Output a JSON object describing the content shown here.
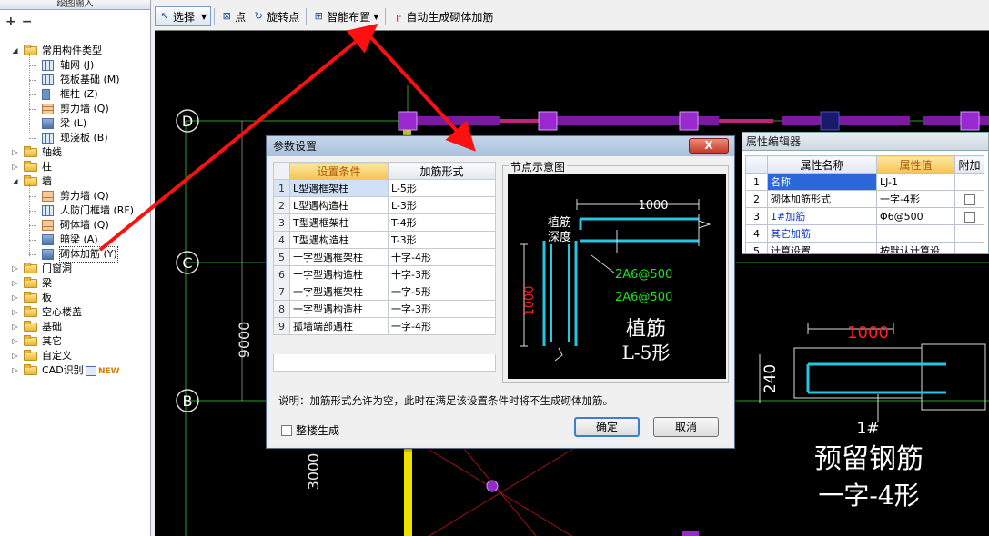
{
  "left_panel": {
    "header": "绘图输入",
    "tools": [
      "+",
      "−"
    ],
    "tree": [
      {
        "label": "常用构件类型",
        "shortcut": ""
      },
      {
        "label": "轴网",
        "shortcut": "(J)"
      },
      {
        "label": "筏板基础",
        "shortcut": "(M)"
      },
      {
        "label": "框柱",
        "shortcut": "(Z)"
      },
      {
        "label": "剪力墙",
        "shortcut": "(Q)"
      },
      {
        "label": "梁",
        "shortcut": "(L)"
      },
      {
        "label": "现浇板",
        "shortcut": "(B)"
      },
      {
        "label": "轴线",
        "shortcut": ""
      },
      {
        "label": "柱",
        "shortcut": ""
      },
      {
        "label": "墙",
        "shortcut": ""
      },
      {
        "label": "剪力墙",
        "shortcut": "(Q)"
      },
      {
        "label": "人防门框墙",
        "shortcut": "(RF)"
      },
      {
        "label": "砌体墙",
        "shortcut": "(Q)"
      },
      {
        "label": "暗梁",
        "shortcut": "(A)"
      },
      {
        "label": "砌体加筋",
        "shortcut": "(Y)"
      },
      {
        "label": "门窗洞",
        "shortcut": ""
      },
      {
        "label": "梁",
        "shortcut": ""
      },
      {
        "label": "板",
        "shortcut": ""
      },
      {
        "label": "空心楼盖",
        "shortcut": ""
      },
      {
        "label": "基础",
        "shortcut": ""
      },
      {
        "label": "其它",
        "shortcut": ""
      },
      {
        "label": "自定义",
        "shortcut": ""
      },
      {
        "label": "CAD识别",
        "shortcut": "",
        "badge": "NEW"
      }
    ]
  },
  "toolbar": {
    "select": "选择",
    "point": "点",
    "rotate_point": "旋转点",
    "smart_layout": "智能布置",
    "auto_generate": "自动生成砌体加筋"
  },
  "canvas": {
    "axes": [
      "D",
      "C",
      "B"
    ],
    "dimensions": [
      "9000",
      "3000"
    ]
  },
  "property_editor": {
    "title": "属性编辑器",
    "headers": [
      "属性名称",
      "属性值",
      "附加"
    ],
    "rows": [
      {
        "num": "1",
        "name": "名称",
        "value": "LJ-1",
        "check": false
      },
      {
        "num": "2",
        "name": "砌体加筋形式",
        "value": "一字-4形",
        "check": true
      },
      {
        "num": "3",
        "name": "1#加筋",
        "value": "Φ6@500",
        "check": true
      },
      {
        "num": "4",
        "name": "其它加筋",
        "value": "",
        "check": false
      },
      {
        "num": "5",
        "name": "计算设置",
        "value": "按默认计算设",
        "check": false
      }
    ]
  },
  "right_preview": {
    "dimension": "1000",
    "side_dim": "240",
    "bar_label": "1#",
    "caption_line1": "预留钢筋",
    "caption_line2": "一字-4形"
  },
  "dialog": {
    "title": "参数设置",
    "close": "X",
    "headers": [
      "设置条件",
      "加筋形式"
    ],
    "rows": [
      {
        "num": "1",
        "condition": "L型遇框架柱",
        "form": "L-5形"
      },
      {
        "num": "2",
        "condition": "L型遇构造柱",
        "form": "L-3形"
      },
      {
        "num": "3",
        "condition": "T型遇框架柱",
        "form": "T-4形"
      },
      {
        "num": "4",
        "condition": "T型遇构造柱",
        "form": "T-3形"
      },
      {
        "num": "5",
        "condition": "十字型遇框架柱",
        "form": "十字-4形"
      },
      {
        "num": "6",
        "condition": "十字型遇构造柱",
        "form": "十字-3形"
      },
      {
        "num": "7",
        "condition": "一字型遇框架柱",
        "form": "一字-5形"
      },
      {
        "num": "8",
        "condition": "一字型遇构造柱",
        "form": "一字-3形"
      },
      {
        "num": "9",
        "condition": "孤墙端部遇柱",
        "form": "一字-4形"
      }
    ],
    "node_group_label": "节点示意图",
    "node": {
      "dim_top": "1000",
      "anchor_label_1": "植筋",
      "anchor_label_2": "深度",
      "rebar_1": "2A6@500",
      "rebar_2": "2A6@500",
      "dim_side": "1000",
      "caption_1": "植筋",
      "caption_2": "L-5形"
    },
    "note": "说明：加筋形式允许为空，此时在满足该设置条件时将不生成砌体加筋。",
    "whole_floor": "整楼生成",
    "ok": "确定",
    "cancel": "取消"
  },
  "colors": {
    "canvas_bg": "#000000",
    "axis_green": "#2f9a2f",
    "purple_column": "#8a1ab0",
    "yellow_wall": "#f0e000",
    "cyan_rebar": "#26c6e0",
    "red_arrow": "#ff1010"
  }
}
